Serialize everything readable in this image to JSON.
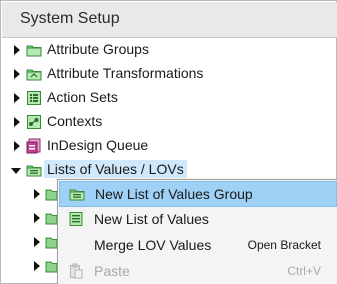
{
  "header": {
    "title": "System Setup"
  },
  "tree": {
    "items": [
      {
        "label": "Attribute Groups",
        "icon": "folder-icon"
      },
      {
        "label": "Attribute Transformations",
        "icon": "transform-folder-icon"
      },
      {
        "label": "Action Sets",
        "icon": "action-sets-icon"
      },
      {
        "label": "Contexts",
        "icon": "contexts-icon"
      },
      {
        "label": "InDesign Queue",
        "icon": "indesign-queue-icon"
      },
      {
        "label": "Lists of Values / LOVs",
        "icon": "lov-folder-icon",
        "expanded": true,
        "selected": true
      }
    ]
  },
  "context_menu": {
    "items": [
      {
        "label": "New List of Values Group",
        "shortcut": "",
        "icon": "new-lov-group-icon",
        "state": "hover"
      },
      {
        "label": "New List of Values",
        "shortcut": "",
        "icon": "new-lov-icon",
        "state": "normal"
      },
      {
        "label": "Merge LOV Values",
        "shortcut": "Open Bracket",
        "icon": "",
        "state": "normal"
      },
      {
        "label": "Paste",
        "shortcut": "Ctrl+V",
        "icon": "paste-icon",
        "state": "disabled"
      }
    ]
  },
  "colors": {
    "header_bg": "#e9e9e9",
    "selection_bg": "#cfe8fb",
    "menu_hover_bg": "#9fd1f6",
    "folder_green": "#7cc576"
  }
}
